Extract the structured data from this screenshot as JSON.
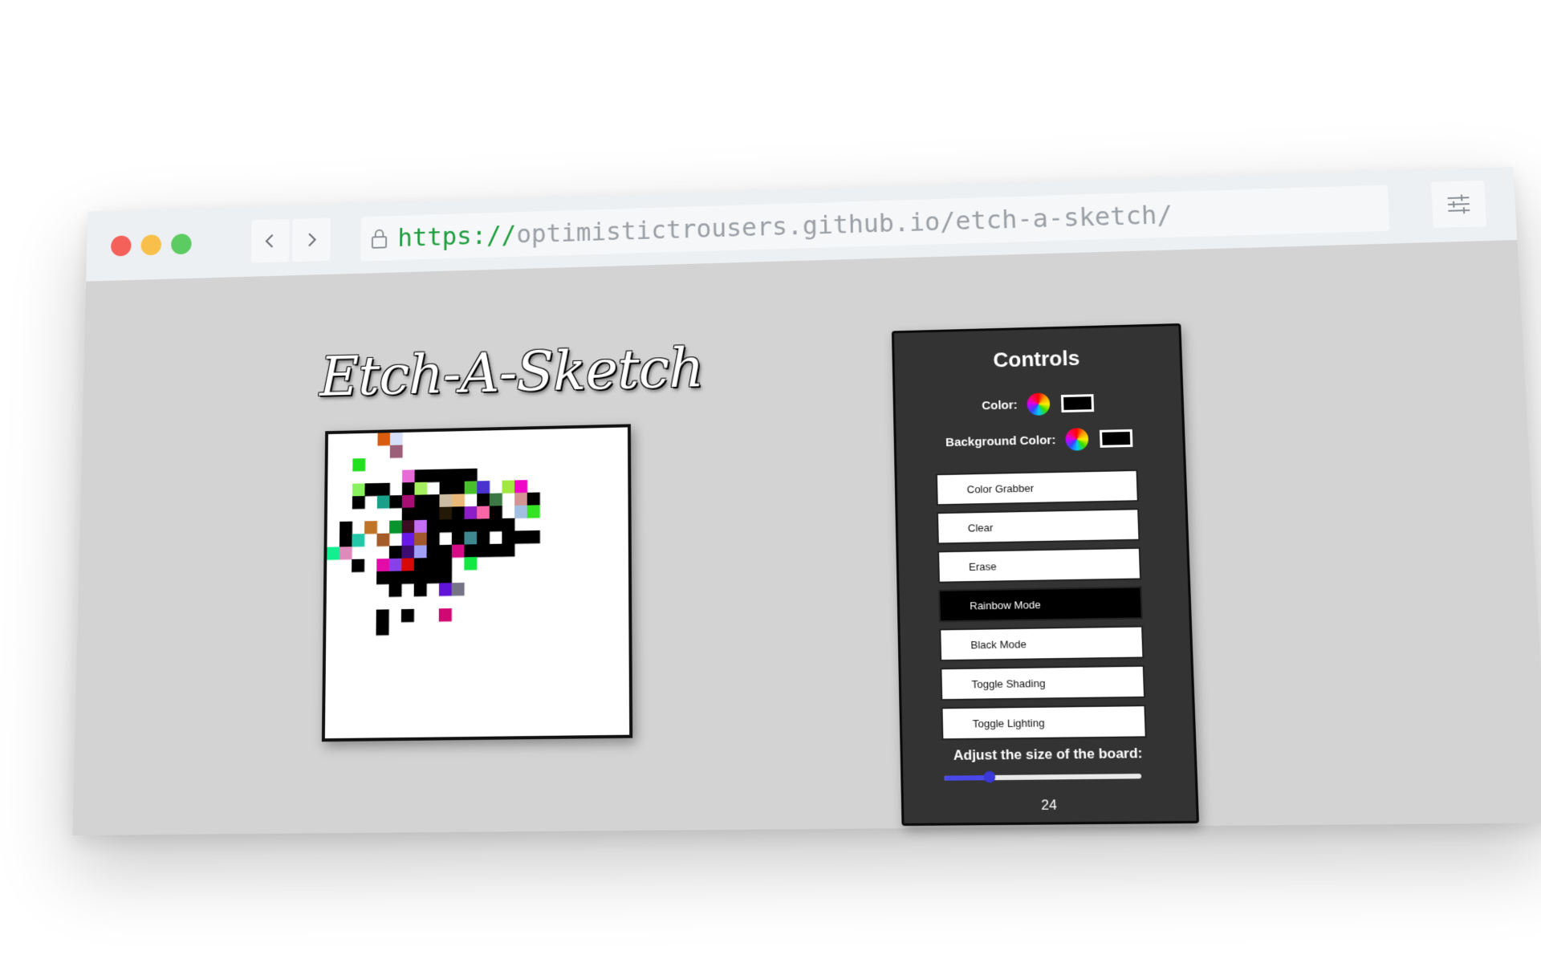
{
  "browser": {
    "url_scheme": "https://",
    "url_rest": "optimistictrousers.github.io/etch-a-sketch/",
    "back_icon": "chevron-left-icon",
    "forward_icon": "chevron-right-icon",
    "menu_icon": "sliders-icon",
    "lock_icon": "lock-icon"
  },
  "app": {
    "title": "Etch-A-Sketch"
  },
  "board": {
    "grid_size": 24,
    "background": "#ffffff",
    "cells": [
      [
        4,
        0,
        "#d85c10"
      ],
      [
        5,
        0,
        "#d6e0f8"
      ],
      [
        5,
        1,
        "#9c5e78"
      ],
      [
        2,
        2,
        "#22e01e"
      ],
      [
        6,
        3,
        "#e86ad6"
      ],
      [
        7,
        3,
        "#000000"
      ],
      [
        8,
        3,
        "#000000"
      ],
      [
        9,
        3,
        "#000000"
      ],
      [
        10,
        3,
        "#000000"
      ],
      [
        11,
        3,
        "#000000"
      ],
      [
        2,
        4,
        "#8af25e"
      ],
      [
        3,
        4,
        "#000000"
      ],
      [
        4,
        4,
        "#000000"
      ],
      [
        6,
        4,
        "#000000"
      ],
      [
        7,
        4,
        "#a6f060"
      ],
      [
        9,
        4,
        "#000000"
      ],
      [
        10,
        4,
        "#000000"
      ],
      [
        11,
        4,
        "#48c02c"
      ],
      [
        12,
        4,
        "#4834cc"
      ],
      [
        14,
        4,
        "#a2e840"
      ],
      [
        15,
        4,
        "#ee08c6"
      ],
      [
        2,
        5,
        "#000000"
      ],
      [
        4,
        5,
        "#18a088"
      ],
      [
        5,
        5,
        "#000000"
      ],
      [
        6,
        5,
        "#a60e74"
      ],
      [
        7,
        5,
        "#000000"
      ],
      [
        8,
        5,
        "#000000"
      ],
      [
        9,
        5,
        "#ccbca4"
      ],
      [
        10,
        5,
        "#e8b878"
      ],
      [
        12,
        5,
        "#000000"
      ],
      [
        13,
        5,
        "#3c7844"
      ],
      [
        15,
        5,
        "#d49494"
      ],
      [
        16,
        5,
        "#000000"
      ],
      [
        6,
        6,
        "#000000"
      ],
      [
        7,
        6,
        "#000000"
      ],
      [
        8,
        6,
        "#000000"
      ],
      [
        9,
        6,
        "#241806"
      ],
      [
        10,
        6,
        "#000000"
      ],
      [
        11,
        6,
        "#8c1ec8"
      ],
      [
        12,
        6,
        "#f866a8"
      ],
      [
        13,
        6,
        "#000000"
      ],
      [
        15,
        6,
        "#a2bee0"
      ],
      [
        16,
        6,
        "#36e224"
      ],
      [
        1,
        7,
        "#000000"
      ],
      [
        3,
        7,
        "#c07428"
      ],
      [
        5,
        7,
        "#07942c"
      ],
      [
        6,
        7,
        "#3c0c22"
      ],
      [
        7,
        7,
        "#c46ef4"
      ],
      [
        8,
        7,
        "#000000"
      ],
      [
        9,
        7,
        "#000000"
      ],
      [
        10,
        7,
        "#000000"
      ],
      [
        11,
        7,
        "#000000"
      ],
      [
        12,
        7,
        "#000000"
      ],
      [
        13,
        7,
        "#000000"
      ],
      [
        14,
        7,
        "#000000"
      ],
      [
        1,
        8,
        "#000000"
      ],
      [
        2,
        8,
        "#24c8a8"
      ],
      [
        4,
        8,
        "#a45c28"
      ],
      [
        6,
        8,
        "#6818e8"
      ],
      [
        7,
        8,
        "#a0582c"
      ],
      [
        8,
        8,
        "#000000"
      ],
      [
        10,
        8,
        "#000000"
      ],
      [
        11,
        8,
        "#408890"
      ],
      [
        12,
        8,
        "#000000"
      ],
      [
        14,
        8,
        "#000000"
      ],
      [
        15,
        8,
        "#000000"
      ],
      [
        16,
        8,
        "#000000"
      ],
      [
        0,
        9,
        "#10f090"
      ],
      [
        1,
        9,
        "#de8aba"
      ],
      [
        5,
        9,
        "#000000"
      ],
      [
        6,
        9,
        "#3c0c70"
      ],
      [
        7,
        9,
        "#a0a0f8"
      ],
      [
        8,
        9,
        "#000000"
      ],
      [
        9,
        9,
        "#000000"
      ],
      [
        10,
        9,
        "#d60c86"
      ],
      [
        11,
        9,
        "#000000"
      ],
      [
        12,
        9,
        "#000000"
      ],
      [
        13,
        9,
        "#000000"
      ],
      [
        14,
        9,
        "#000000"
      ],
      [
        2,
        10,
        "#000000"
      ],
      [
        4,
        10,
        "#e40ca8"
      ],
      [
        5,
        10,
        "#8840e8"
      ],
      [
        6,
        10,
        "#d60808"
      ],
      [
        7,
        10,
        "#000000"
      ],
      [
        8,
        10,
        "#000000"
      ],
      [
        9,
        10,
        "#000000"
      ],
      [
        11,
        10,
        "#14e844"
      ],
      [
        4,
        11,
        "#000000"
      ],
      [
        5,
        11,
        "#000000"
      ],
      [
        6,
        11,
        "#000000"
      ],
      [
        7,
        11,
        "#000000"
      ],
      [
        8,
        11,
        "#000000"
      ],
      [
        9,
        11,
        "#000000"
      ],
      [
        5,
        12,
        "#000000"
      ],
      [
        7,
        12,
        "#000000"
      ],
      [
        9,
        12,
        "#6014d8"
      ],
      [
        10,
        12,
        "#747486"
      ],
      [
        4,
        14,
        "#000000"
      ],
      [
        6,
        14,
        "#000000"
      ],
      [
        9,
        14,
        "#d00872"
      ],
      [
        4,
        15,
        "#000000"
      ]
    ]
  },
  "controls": {
    "title": "Controls",
    "color_label": "Color:",
    "bg_color_label": "Background Color:",
    "color_wheel_icon": "color-wheel-icon",
    "current_color": "#000000",
    "current_bg_color": "#000000",
    "buttons": [
      {
        "label": "Color Grabber",
        "active": false
      },
      {
        "label": "Clear",
        "active": false
      },
      {
        "label": "Erase",
        "active": false
      },
      {
        "label": "Rainbow Mode",
        "active": true
      },
      {
        "label": "Black Mode",
        "active": false
      },
      {
        "label": "Toggle Shading",
        "active": false
      },
      {
        "label": "Toggle Lighting",
        "active": false
      }
    ],
    "size_label": "Adjust the size of the board:",
    "size_value": "24",
    "size_min": 1,
    "size_max": 100,
    "accent": "#4a48e8"
  }
}
